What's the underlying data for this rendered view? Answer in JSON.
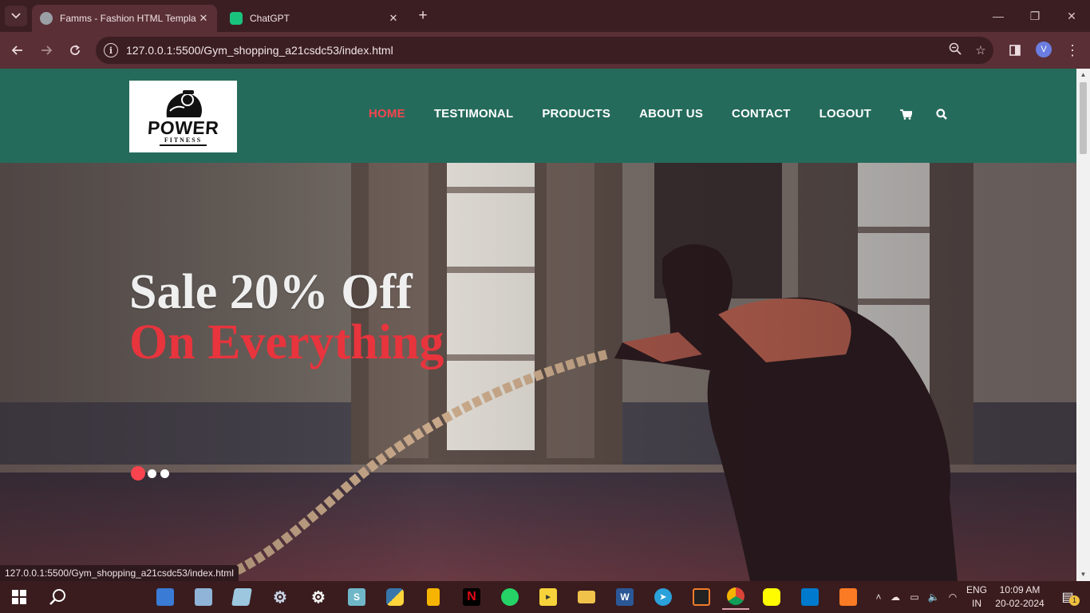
{
  "browser": {
    "tabs": [
      {
        "title": "Famms - Fashion HTML Templat",
        "favicon_color": "#9aa0a6",
        "active": true
      },
      {
        "title": "ChatGPT",
        "favicon_color": "#19c37d",
        "active": false
      }
    ],
    "new_tab_label": "+",
    "address": "127.0.0.1:5500/Gym_shopping_a21csdc53/index.html",
    "profile_initial": "V",
    "status_url": "127.0.0.1:5500/Gym_shopping_a21csdc53/index.html"
  },
  "site": {
    "logo": {
      "word1": "POWER",
      "word2": "FITNESS"
    },
    "nav": [
      {
        "label": "HOME",
        "active": true
      },
      {
        "label": "TESTIMONAL",
        "active": false
      },
      {
        "label": "PRODUCTS",
        "active": false
      },
      {
        "label": "ABOUT US",
        "active": false
      },
      {
        "label": "CONTACT",
        "active": false
      },
      {
        "label": "LOGOUT",
        "active": false
      }
    ],
    "nav_icons": [
      "cart-icon",
      "search-icon"
    ],
    "colors": {
      "header": "#256b5c",
      "accent": "#f7444e"
    },
    "hero": {
      "line1": "Sale 20% Off",
      "line2": "On Everything",
      "slides": 3,
      "active_slide": 1
    }
  },
  "taskbar": {
    "language": {
      "line1": "ENG",
      "line2": "IN"
    },
    "clock": {
      "time": "10:09 AM",
      "date": "20-02-2024"
    },
    "notification_count": "1"
  }
}
